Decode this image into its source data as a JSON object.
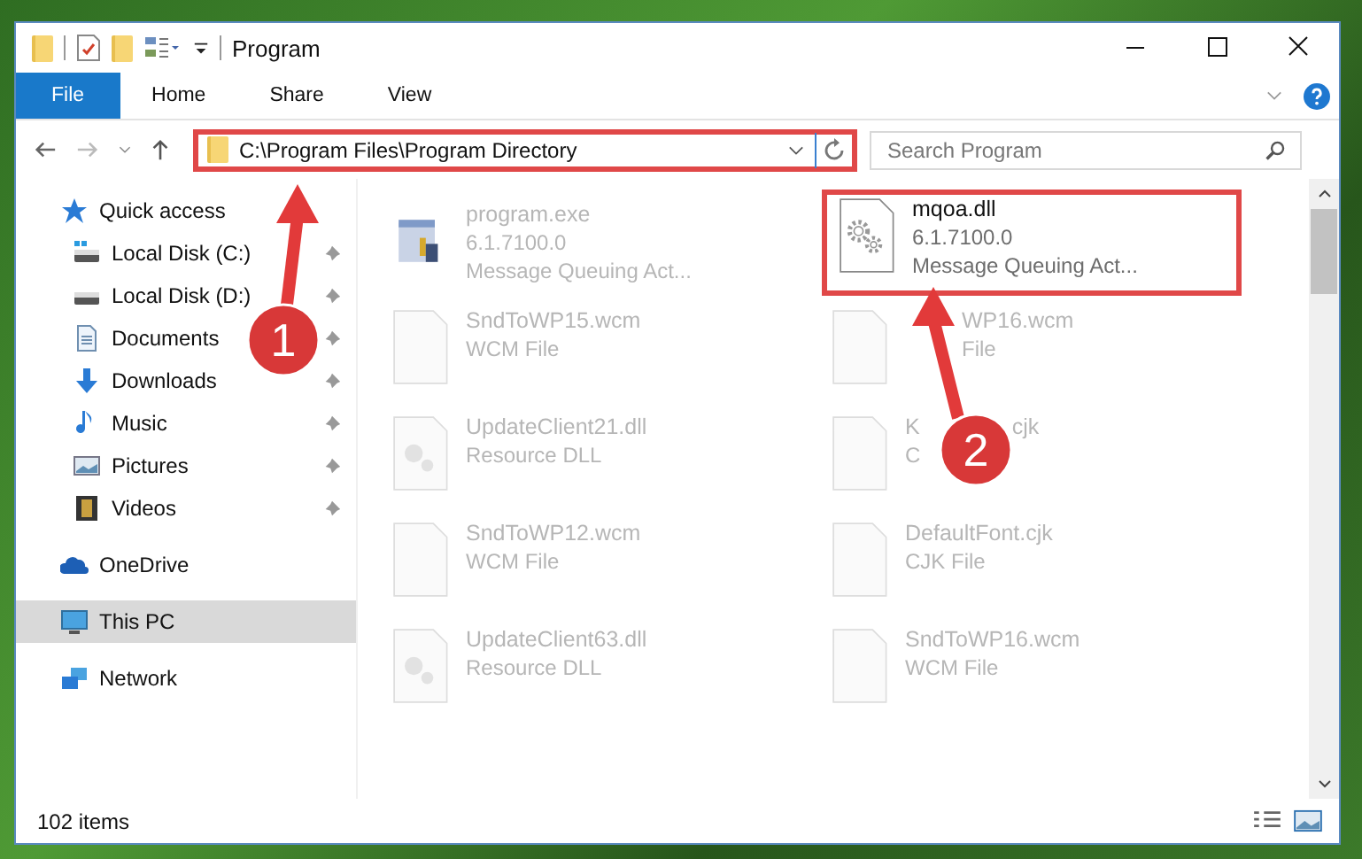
{
  "window": {
    "title": "Program"
  },
  "ribbon": {
    "tabs": [
      {
        "label": "File",
        "selected": true
      },
      {
        "label": "Home",
        "selected": false
      },
      {
        "label": "Share",
        "selected": false
      },
      {
        "label": "View",
        "selected": false
      }
    ]
  },
  "address_bar": {
    "path": "C:\\Program Files\\Program Directory",
    "highlighted": true
  },
  "search": {
    "placeholder": "Search Program"
  },
  "sidebar": {
    "items": [
      {
        "label": "Quick access",
        "selected": false,
        "children": [
          {
            "label": "Local Disk (C:)",
            "pinned": true,
            "selected": false
          },
          {
            "label": "Local Disk (D:)",
            "pinned": true,
            "selected": false
          },
          {
            "label": "Documents",
            "pinned": true,
            "selected": false
          },
          {
            "label": "Downloads",
            "pinned": true,
            "selected": false
          },
          {
            "label": "Music",
            "pinned": true,
            "selected": false
          },
          {
            "label": "Pictures",
            "pinned": true,
            "selected": false
          },
          {
            "label": "Videos",
            "pinned": true,
            "selected": false
          }
        ]
      },
      {
        "label": "OneDrive",
        "selected": false
      },
      {
        "label": "This PC",
        "selected": true
      },
      {
        "label": "Network",
        "selected": false
      }
    ]
  },
  "files": [
    {
      "name_parts": [
        "program.exe"
      ],
      "details": [
        "6.1.7100.0",
        "Message Queuing Act..."
      ],
      "faded": true,
      "highlighted": false
    },
    {
      "name_parts": [
        "mqoa.dll"
      ],
      "details": [
        "6.1.7100.0",
        "Message Queuing Act..."
      ],
      "faded": false,
      "highlighted": true
    },
    {
      "name_parts": [
        "SndToWP15.wcm"
      ],
      "details": [
        "WCM File"
      ],
      "faded": true,
      "highlighted": false
    },
    {
      "name_parts": [
        "WP16.wcm"
      ],
      "details": [
        "File"
      ],
      "faded": true,
      "highlighted": false,
      "lead_covered": true
    },
    {
      "name_parts": [
        "UpdateClient21.dll"
      ],
      "details": [
        "Resource DLL"
      ],
      "faded": true,
      "highlighted": false
    },
    {
      "name_parts": [
        "K",
        "cjk"
      ],
      "details": [
        "C"
      ],
      "faded": true,
      "highlighted": false
    },
    {
      "name_parts": [
        "SndToWP12.wcm"
      ],
      "details": [
        "WCM File"
      ],
      "faded": true,
      "highlighted": false
    },
    {
      "name_parts": [
        "DefaultFont.cjk"
      ],
      "details": [
        "CJK File"
      ],
      "faded": true,
      "highlighted": false
    },
    {
      "name_parts": [
        "UpdateClient63.dll"
      ],
      "details": [
        "Resource DLL"
      ],
      "faded": true,
      "highlighted": false
    },
    {
      "name_parts": [
        "SndToWP16.wcm"
      ],
      "details": [
        "WCM File"
      ],
      "faded": true,
      "highlighted": false
    }
  ],
  "status_bar": {
    "item_count": "102 items"
  },
  "annotations": [
    {
      "label": "1"
    },
    {
      "label": "2"
    }
  ]
}
